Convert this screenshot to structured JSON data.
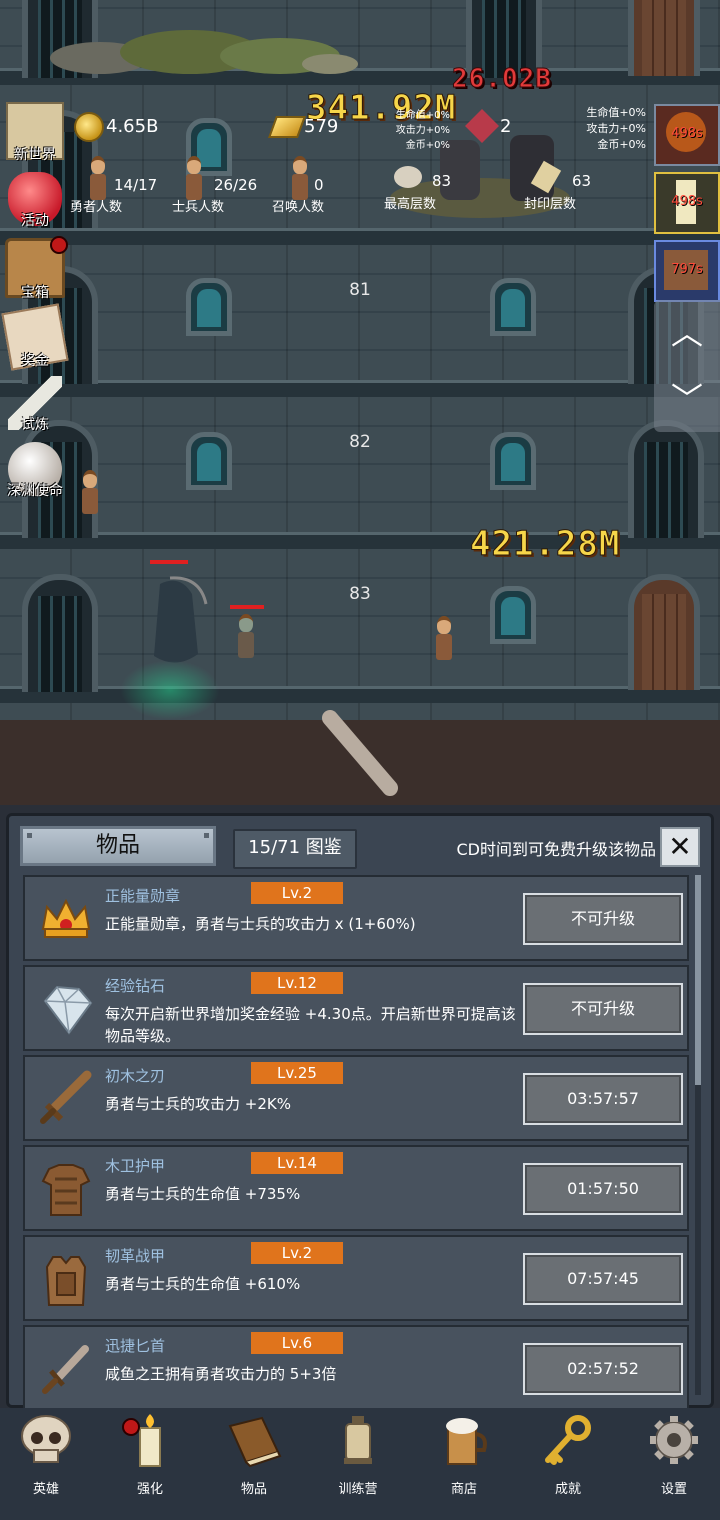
{
  "game": {
    "top_stats": {
      "gold": "4.65B",
      "gold_bars": "579",
      "gem_count": "2",
      "hero_count": "14/17",
      "hero_label": "勇者人数",
      "soldier_count": "26/26",
      "soldier_label": "士兵人数",
      "summon_count": "0",
      "summon_label": "召唤人数",
      "max_floor": "83",
      "max_floor_label": "最高层数",
      "seal_floor": "63",
      "seal_floor_label": "封印层数"
    },
    "buffs": [
      "生命值+0%",
      "攻击力+0%",
      "金币+0%"
    ],
    "buffs_overlay": [
      "生命值+0%",
      "攻击力+0%",
      "金币+0%"
    ],
    "timers": [
      "498s",
      "498s",
      "797s"
    ],
    "side_menu": [
      "新世界",
      "活动",
      "宝箱",
      "奖金",
      "试炼",
      "深渊使命"
    ],
    "floors": [
      "81",
      "82",
      "83"
    ],
    "damage_numbers": {
      "top_gold": "341.92M",
      "top_red": "26.02B",
      "mid_gold": "421.28M"
    },
    "scroll_up": "︿",
    "scroll_down": "﹀"
  },
  "panel": {
    "tab_label": "物品",
    "collection": "15/71 图鉴",
    "hint": "CD时间到可免费升级该物品",
    "close": "✕",
    "items": [
      {
        "name": "正能量勋章",
        "level": "Lv.2",
        "desc": "正能量勋章，勇者与士兵的攻击力 x (1+60%)",
        "action": "不可升级",
        "icon": "crown-medal-icon"
      },
      {
        "name": "经验钻石",
        "level": "Lv.12",
        "desc": "每次开启新世界增加奖金经验 +4.30点。开启新世界可提高该物品等级。",
        "action": "不可升级",
        "icon": "diamond-icon"
      },
      {
        "name": "初木之刃",
        "level": "Lv.25",
        "desc": "勇者与士兵的攻击力 +2K%",
        "action": "03:57:57",
        "icon": "wooden-sword-icon"
      },
      {
        "name": "木卫护甲",
        "level": "Lv.14",
        "desc": "勇者与士兵的生命值 +735%",
        "action": "01:57:50",
        "icon": "wooden-armor-icon"
      },
      {
        "name": "韧革战甲",
        "level": "Lv.2",
        "desc": "勇者与士兵的生命值 +610%",
        "action": "07:57:45",
        "icon": "leather-armor-icon"
      },
      {
        "name": "迅捷匕首",
        "level": "Lv.6",
        "desc": "咸鱼之王拥有勇者攻击力的 5+3倍",
        "action": "02:57:52",
        "icon": "dagger-icon"
      }
    ]
  },
  "nav": [
    "英雄",
    "强化",
    "物品",
    "训练营",
    "商店",
    "成就",
    "设置"
  ],
  "colors": {
    "level_badge": "#e0741c",
    "item_name": "#9fc1e0",
    "damage_gold": "#f7d64a",
    "damage_red": "#e23a3a"
  }
}
